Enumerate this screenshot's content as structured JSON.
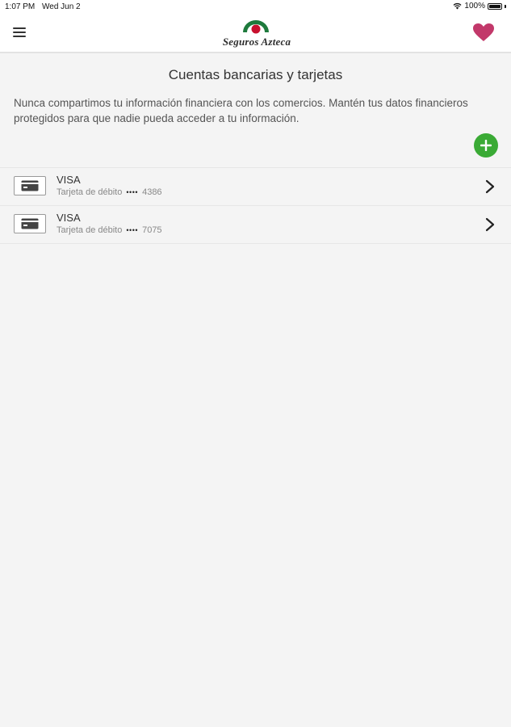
{
  "status_bar": {
    "time": "1:07 PM",
    "date": "Wed Jun 2",
    "battery": "100%",
    "wifi_icon": "wifi-icon",
    "battery_icon": "battery-icon"
  },
  "header": {
    "menu_icon": "hamburger-menu-icon",
    "logo_text": "Seguros Azteca",
    "favorite_icon": "heart-icon"
  },
  "page": {
    "title": "Cuentas bancarias y tarjetas",
    "description": "Nunca compartimos tu información financiera con los comercios. Mantén tus datos financieros protegidos para que nadie pueda acceder a tu información.",
    "add_icon": "plus-icon"
  },
  "cards": [
    {
      "brand": "VISA",
      "type": "Tarjeta de débito",
      "mask": "••••",
      "last4": "4386",
      "icon": "credit-card-icon"
    },
    {
      "brand": "VISA",
      "type": "Tarjeta de débito",
      "mask": "••••",
      "last4": "7075",
      "icon": "credit-card-icon"
    }
  ],
  "colors": {
    "accent_green": "#3aaa35",
    "heart_pink": "#c2386a",
    "logo_red": "#c8102e",
    "logo_green": "#1e7a3c",
    "background": "#f4f4f4"
  }
}
